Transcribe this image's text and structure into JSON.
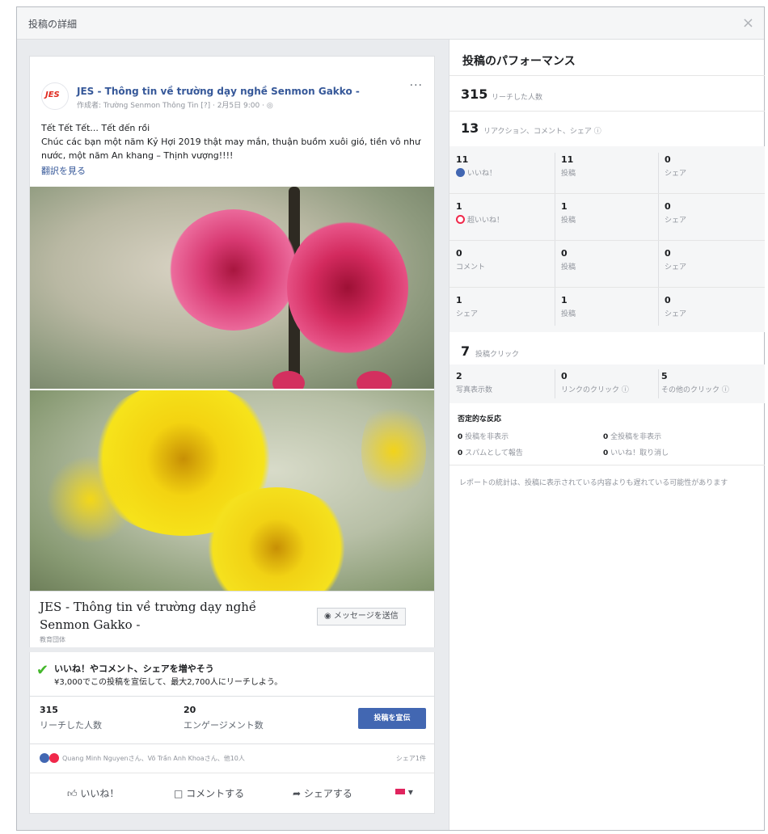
{
  "dialog": {
    "title": "投稿の詳細",
    "close": "×"
  },
  "post": {
    "avatar_text": "JES",
    "page_name": "JES - Thông tin về trường dạy nghề Senmon Gakko -",
    "meta": "作成者: Trường Senmon Thông Tin [?] · 2月5日 9:00 · ",
    "more": "···",
    "text_line1": "Tết Tết Tết... Tết đến rồi",
    "text_line2": "Chúc các bạn một năm Kỷ Hợi 2019 thật may mắn, thuận buồm xuôi gió, tiền vô như nước, một năm An khang – Thịnh vượng!!!!",
    "translate": "翻訳を見る",
    "link_title": "JES - Thông tin về trường dạy nghề Senmon Gakko -",
    "link_sub": "教育団体",
    "message_button": "メッセージを送信"
  },
  "boost": {
    "title": "いいね！やコメント、シェアを増やそう",
    "sub": "¥3,000でこの投稿を宣伝して、最大2,700人にリーチしよう。",
    "reach_num": "315",
    "reach_label": "リーチした人数",
    "eng_num": "20",
    "eng_label": "エンゲージメント数",
    "button": "投稿を宣伝"
  },
  "reactions": {
    "names": "Quang Minh Nguyenさん、Võ Trần Anh Khoaさん、他10人",
    "shares": "シェア1件",
    "like": "いいね！",
    "comment": "コメントする",
    "share": "シェアする"
  },
  "performance": {
    "title": "投稿のパフォーマンス",
    "reach_num": "315",
    "reach_label": "リーチした人数",
    "react_num": "13",
    "react_label": "リアクション、コメント、シェア",
    "rows": [
      {
        "n1": "11",
        "l1": "いいね！",
        "n2": "11",
        "l2": "投稿",
        "n3": "0",
        "l3": "シェア"
      },
      {
        "n1": "1",
        "l1": "超いいね！",
        "n2": "1",
        "l2": "投稿",
        "n3": "0",
        "l3": "シェア"
      },
      {
        "n1": "0",
        "l1": "コメント",
        "n2": "0",
        "l2": "投稿",
        "n3": "0",
        "l3": "シェア"
      },
      {
        "n1": "1",
        "l1": "シェア",
        "n2": "1",
        "l2": "投稿",
        "n3": "0",
        "l3": "シェア"
      }
    ],
    "clicks_num": "7",
    "clicks_label": "投稿クリック",
    "c1_num": "2",
    "c1_label": "写真表示数",
    "c2_num": "0",
    "c2_label": "リンクのクリック",
    "c3_num": "5",
    "c3_label": "その他のクリック",
    "neg_title": "否定的な反応",
    "neg1_num": "0",
    "neg1_label": "投稿を非表示",
    "neg2_num": "0",
    "neg2_label": "全投稿を非表示",
    "neg3_num": "0",
    "neg3_label": "スパムとして報告",
    "neg4_num": "0",
    "neg4_label": "いいね！取り消し",
    "note": "レポートの統計は、投稿に表示されている内容よりも遅れている可能性があります"
  },
  "colors": {
    "accent": "#4267b2",
    "link": "#365899",
    "love": "#f0284a",
    "check": "#42b72a"
  }
}
